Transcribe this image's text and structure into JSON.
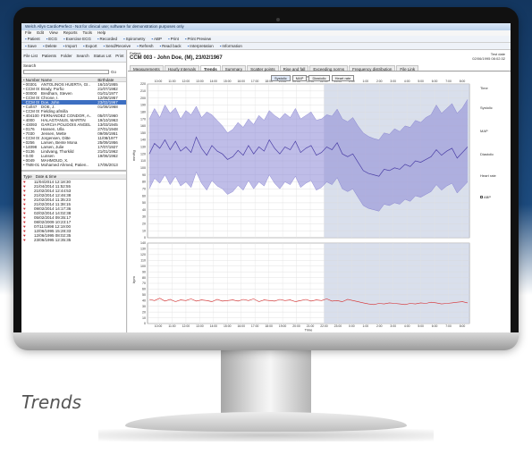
{
  "window": {
    "title": "Welch Allyn CardioPerfect - Not for clinical use; software for demonstration purposes only"
  },
  "menu": [
    "File",
    "Edit",
    "View",
    "Reports",
    "Tools",
    "Help"
  ],
  "toolbar1": [
    "Patient",
    "ECG",
    "Exercise ECG",
    "Recorded",
    "Spirometry",
    "ABP",
    "Print",
    "Print Preview"
  ],
  "toolbar2": [
    "Save",
    "Delete",
    "Import",
    "Export",
    "Send/Receive",
    "Refresh",
    "Read back",
    "Interpretation",
    "Information"
  ],
  "left": {
    "nav": [
      "File List",
      "Patients",
      "Folder",
      "Search",
      "Status Lst",
      "Print"
    ],
    "search_label": "Search",
    "go": "Go",
    "patient_columns": [
      "Number",
      "Name",
      "Birthdate"
    ],
    "patients": [
      [
        "00301",
        "ANTOLINOS HUERTA, GI..",
        "16/10/1955"
      ],
      [
        "CCM 001",
        "Brady, Porfio",
        "21/07/1982"
      ],
      [
        "00000",
        "Bredham, Steven",
        "01/01/1977"
      ],
      [
        "CCM 003",
        "Chrone, I.",
        "12/08/1957"
      ],
      [
        "CCM 003",
        "Doe, John",
        "23/02/1967"
      ],
      [
        "Coll47",
        "DOE, J.",
        "01/08/1968"
      ],
      [
        "CCM 007",
        "Fielding afmilla",
        ""
      ],
      [
        "404100",
        "FERNANDEZ CONDOR, A..",
        "05/07/1960"
      ],
      [
        "4000",
        "HALAGTANUS, MARTIN",
        "19/10/1963"
      ],
      [
        "43093",
        "GARCIA POLIDOIS ANGEL",
        "13/03/1945"
      ],
      [
        "0176",
        "Hansen, Ulla",
        "27/01/1948"
      ],
      [
        "7030",
        "Jensen, Mette",
        "09/09/1951"
      ],
      [
        "CCM 001",
        "Jorgensen, Ditte",
        "11/08/1977"
      ],
      [
        "0256",
        "Larsen, Bente Mona",
        "25/09/1956"
      ],
      [
        "14098",
        "Larsen, Julie",
        "17/07/1927"
      ],
      [
        "0136",
        "Lindvang, Thorkild",
        "21/01/1962"
      ],
      [
        "0.00",
        "Lunsen",
        "19/06/1962"
      ],
      [
        "0049",
        "MAHMOUD, X.",
        ""
      ],
      [
        "TM8-010",
        "Mohamed Ahmed, Patien..",
        "17/05/2013"
      ]
    ],
    "record_columns": [
      "Type",
      "Date & time"
    ],
    "records": [
      "11/04/2014 12:18:30",
      "21/04/2014 11:52:55",
      "21/02/2014 12:44:53",
      "21/02/2014 12:46:38",
      "21/02/2014 11:35:23",
      "21/02/2014 11:38:15",
      "09/02/2014 14:17:36",
      "02/02/2014 14:02:38",
      "05/02/2014 09:35:17",
      "08/02/2009 10:23:17",
      "07/11/1998 12:19:00",
      "12/06/1995 15:28:33",
      "12/06/1995 08:02:35",
      "23/06/1995 12:35:35"
    ]
  },
  "right": {
    "patient_label": "Patient",
    "patient_title": "CCM 003 - John Doe, (M), 23/02/1967",
    "test_date_label": "Test date",
    "test_date": "02/06/1995 08:02:32",
    "tabs": [
      "Measurements",
      "Hourly Intervals",
      "Trends",
      "Summary",
      "Scatter points",
      "Rise and fall",
      "Exceeding norms",
      "Frequency distribution",
      "File Link"
    ],
    "active_tab": "Trends",
    "legend": [
      "Systolic",
      "MAP",
      "Diastolic",
      "Heart rate"
    ],
    "side_items": [
      "Time",
      "Systolic",
      "MAP",
      "Diastolic",
      "Heart rate",
      "ABP"
    ]
  },
  "chart_data": [
    {
      "type": "area",
      "title": "",
      "xlabel": "Time",
      "ylabel": "mmHg",
      "x_ticks": [
        "10:00",
        "11:00",
        "12:00",
        "13:00",
        "14:00",
        "15:00",
        "16:00",
        "17:00",
        "18:00",
        "19:00",
        "20:00",
        "21:00",
        "22:00",
        "23:00",
        "0:00",
        "1:00",
        "2:00",
        "3:00",
        "4:00",
        "5:00",
        "6:00",
        "7:00",
        "8:00"
      ],
      "ylim": [
        0,
        220
      ],
      "y_ticks": [
        0,
        10,
        20,
        30,
        40,
        50,
        60,
        70,
        80,
        90,
        100,
        110,
        120,
        130,
        140,
        150,
        160,
        170,
        180,
        190,
        200,
        210,
        220
      ],
      "night_start": "22:00",
      "series": [
        {
          "values": [
            170,
            185,
            172,
            190,
            178,
            186,
            170,
            182,
            176,
            188,
            172,
            180,
            176,
            168,
            160,
            150,
            155,
            165,
            158,
            170,
            162,
            175,
            168,
            182,
            175,
            170,
            178,
            172,
            185,
            170,
            175,
            180,
            168,
            170,
            176,
            174,
            184,
            170,
            166,
            172,
            160,
            150,
            145,
            142,
            140,
            150,
            148,
            156,
            152,
            160,
            158,
            168,
            165,
            172,
            176,
            190,
            178,
            185,
            192,
            178,
            186,
            198
          ]
        },
        {
          "values": [
            120,
            135,
            128,
            140,
            126,
            138,
            124,
            130,
            122,
            144,
            128,
            118,
            132,
            124,
            120,
            112,
            116,
            125,
            118,
            132,
            120,
            130,
            124,
            140,
            128,
            120,
            130,
            126,
            138,
            122,
            128,
            132,
            118,
            122,
            130,
            126,
            136,
            120,
            116,
            120,
            108,
            96,
            92,
            90,
            88,
            98,
            96,
            100,
            98,
            105,
            102,
            110,
            108,
            112,
            116,
            126,
            118,
            124,
            128,
            114,
            122,
            130
          ]
        },
        {
          "values": [
            70,
            85,
            78,
            90,
            76,
            88,
            74,
            80,
            72,
            94,
            78,
            68,
            82,
            74,
            70,
            62,
            66,
            75,
            68,
            82,
            70,
            80,
            74,
            90,
            78,
            70,
            80,
            76,
            88,
            72,
            78,
            82,
            68,
            72,
            80,
            76,
            86,
            70,
            66,
            70,
            58,
            46,
            42,
            40,
            38,
            48,
            46,
            50,
            48,
            55,
            52,
            60,
            58,
            62,
            66,
            76,
            68,
            74,
            78,
            64,
            72,
            80
          ]
        }
      ],
      "colors": {
        "band": "#8a86d6",
        "line": "#4b3fa6"
      }
    },
    {
      "type": "line",
      "title": "",
      "xlabel": "Time",
      "ylabel": "bpm",
      "ylim": [
        0,
        140
      ],
      "y_ticks": [
        0,
        10,
        20,
        30,
        40,
        50,
        60,
        70,
        80,
        90,
        100,
        110,
        120,
        130,
        140
      ],
      "series": [
        {
          "values": [
            42,
            40,
            44,
            39,
            42,
            38,
            41,
            40,
            43,
            39,
            41,
            40,
            38,
            42,
            39,
            40,
            41,
            39,
            42,
            40,
            43,
            38,
            41,
            40,
            39,
            42,
            40,
            41,
            38,
            40,
            42,
            39,
            41,
            40,
            43,
            39,
            40,
            38,
            42,
            40,
            38,
            36,
            34,
            33,
            35,
            34,
            36,
            35,
            34,
            33,
            35,
            34,
            36,
            35,
            37,
            36,
            34,
            35,
            36,
            37,
            38,
            36
          ]
        }
      ],
      "colors": {
        "line": "#d62a2a"
      }
    }
  ],
  "caption": "Trends"
}
